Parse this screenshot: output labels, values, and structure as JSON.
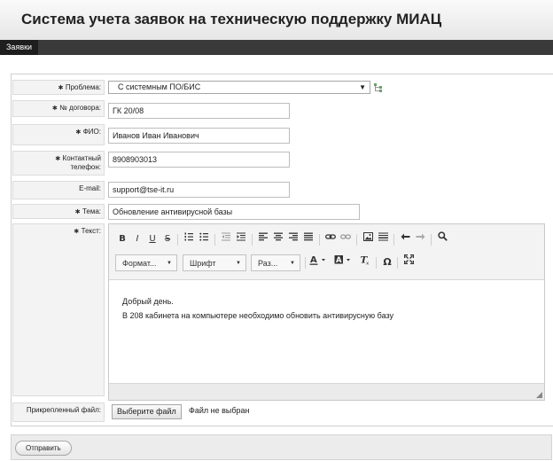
{
  "app": {
    "title": "Система учета заявок на техническую поддержку МИАЦ"
  },
  "nav": {
    "tabs": [
      "Заявки"
    ]
  },
  "form": {
    "problem": {
      "label": "Проблема:",
      "value": "С системным ПО/БИС",
      "required": true
    },
    "contract": {
      "label": "№ договора:",
      "value": "ГК 20/08",
      "required": true
    },
    "fio": {
      "label": "ФИО:",
      "value": "Иванов Иван Иванович",
      "required": true
    },
    "phone": {
      "label_line1": "Контактный",
      "label_line2": "телефон:",
      "value": "8908903013",
      "required": true
    },
    "email": {
      "label": "E-mail:",
      "value": "support@tse-it.ru",
      "required": false
    },
    "subject": {
      "label": "Тема:",
      "value": "Обновление антивирусной базы",
      "required": true
    },
    "text": {
      "label": "Текст:",
      "required": true,
      "body": [
        "Добрый день.",
        "В 208 кабинета на компьютере необходимо обновить антивирусную базу"
      ]
    },
    "attachment": {
      "label": "Прикрепленный файл:",
      "button": "Выберите файл",
      "status": "Файл не выбран"
    }
  },
  "editor": {
    "dropdowns": {
      "format": "Формат...",
      "font": "Шрифт",
      "size": "Раз..."
    },
    "icons": {
      "bold": "B",
      "italic": "I",
      "underline": "U",
      "strike": "S",
      "special_char": "Ω"
    }
  },
  "footer": {
    "submit": "Отправить"
  },
  "required_mark": "∗",
  "icons": [
    "tree-icon",
    "search-icon",
    "undo-icon",
    "redo-icon",
    "link-icon",
    "unlink-icon",
    "image-icon",
    "maximize-icon"
  ]
}
